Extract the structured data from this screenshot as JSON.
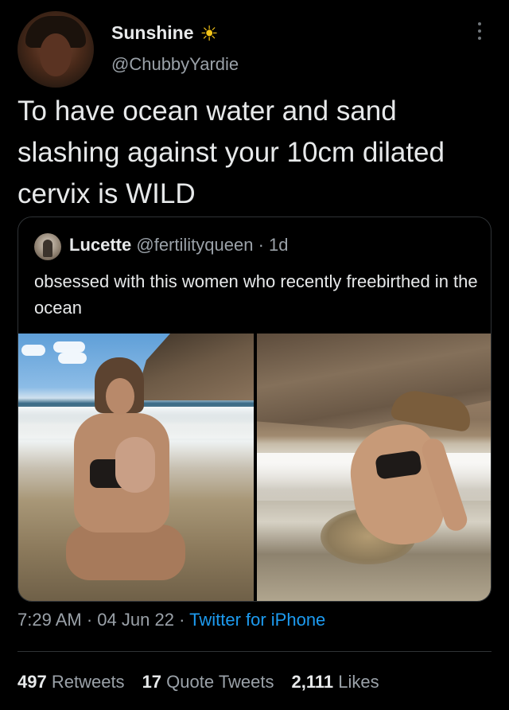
{
  "author": {
    "display_name": "Sunshine",
    "handle": "@ChubbyYardie",
    "badge_icon": "sun-icon"
  },
  "tweet": {
    "text": "To have ocean water and sand slashing against your 10cm dilated cervix is WILD"
  },
  "quoted": {
    "display_name": "Lucette",
    "handle": "@fertilityqueen",
    "separator": "·",
    "age": "1d",
    "text": "obsessed with this women who recently freebirthed in the ocean"
  },
  "meta": {
    "time": "7:29 AM",
    "separator": "·",
    "date": "04 Jun 22",
    "client": "Twitter for iPhone"
  },
  "stats": {
    "retweets_count": "497",
    "retweets_label": "Retweets",
    "quotes_count": "17",
    "quotes_label": "Quote Tweets",
    "likes_count": "2,111",
    "likes_label": "Likes"
  },
  "colors": {
    "background": "#000000",
    "text": "#e7e9ea",
    "secondary": "#9aa1a8",
    "link": "#1d9bf0",
    "border": "#2f3336",
    "sun": "#f5c518"
  }
}
